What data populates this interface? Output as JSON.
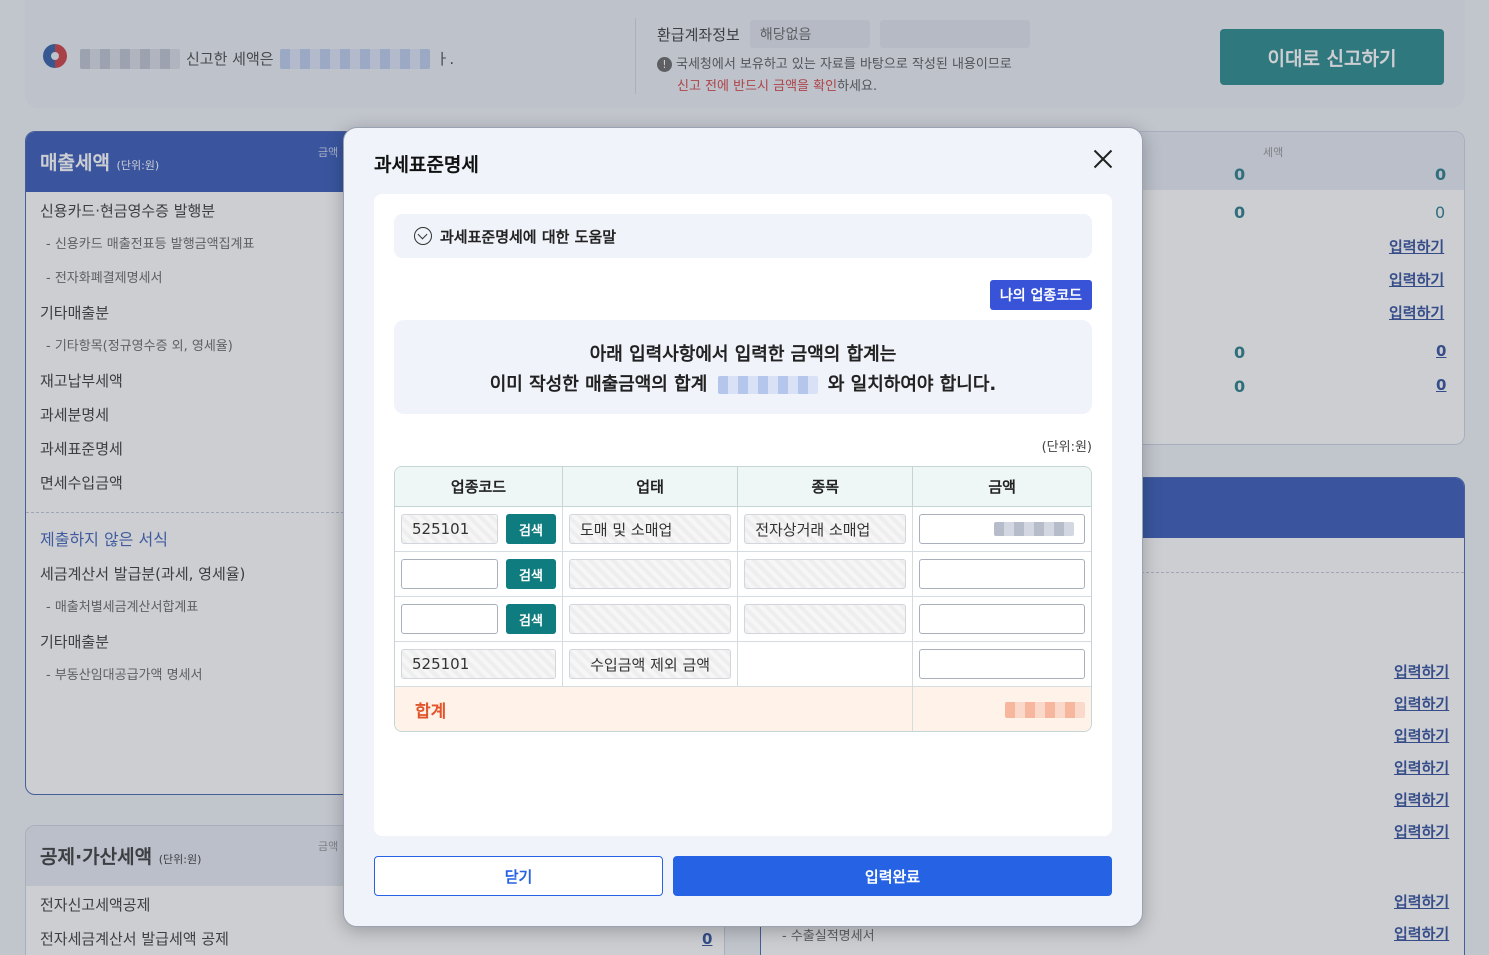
{
  "header": {
    "declared_text": "신고한 세액은",
    "declared_suffix": "ㅏ.",
    "refund_label": "환급계좌정보",
    "refund_value": "해당없음",
    "notice_line1": "국세청에서 보유하고 있는 자료를 바탕으로 작성된 내용이므로",
    "notice_red": "신고 전에 반드시 금액을 확인",
    "notice_tail": "하세요.",
    "report_button": "이대로 신고하기"
  },
  "sales_panel": {
    "title": "매출세액",
    "unit": "(단위:원)",
    "amount_label": "금액",
    "items": [
      {
        "label": "신용카드·현금영수증 발행분",
        "type": "main"
      },
      {
        "label": "- 신용카드 매출전표등 발행금액집계표",
        "type": "sub"
      },
      {
        "label": "- 전자화폐결제명세서",
        "type": "sub"
      },
      {
        "label": "기타매출분",
        "type": "main"
      },
      {
        "label": "- 기타항목(정규영수증 외, 영세율)",
        "type": "sub"
      },
      {
        "label": "재고납부세액",
        "type": "main"
      },
      {
        "label": "과세분명세",
        "type": "main"
      },
      {
        "label": "과세표준명세",
        "type": "main"
      },
      {
        "label": "면세수입금액",
        "type": "main"
      }
    ],
    "unsubmitted_title": "제출하지 않은 서식",
    "unsubmitted_items": [
      {
        "label": "세금계산서 발급분(과세, 영세율)",
        "type": "main"
      },
      {
        "label": "- 매출처별세금계산서합계표",
        "type": "sub"
      },
      {
        "label": "기타매출분",
        "type": "main"
      },
      {
        "label": "- 부동산임대공급가액 명세서",
        "type": "sub"
      }
    ]
  },
  "deduction_panel": {
    "title": "공제·가산세액",
    "unit": "(단위:원)",
    "amount_label": "금액",
    "items": [
      "전자신고세액공제",
      "전자세금계산서 발급세액 공제"
    ],
    "value_zero": "0"
  },
  "right_panel": {
    "tax_label": "세액",
    "zero": "0",
    "link": "입력하기",
    "bottom_sub": "- 수출실적명세서"
  },
  "modal": {
    "title": "과세표준명세",
    "help": "과세표준명세에 대한 도움말",
    "my_code_button": "나의 업종코드",
    "notice_line1": "아래 입력사항에서 입력한 금액의 합계는",
    "notice_line2_pre": "이미 작성한 매출금액의 합계",
    "notice_line2_post": "와 일치하여야 합니다.",
    "unit": "(단위:원)",
    "columns": [
      "업종코드",
      "업태",
      "종목",
      "금액"
    ],
    "search_label": "검색",
    "rows": [
      {
        "code": "525101",
        "biz_type": "도매 및 소매업",
        "item": "전자상거래 소매업"
      },
      {
        "code": "",
        "biz_type": "",
        "item": ""
      },
      {
        "code": "",
        "biz_type": "",
        "item": ""
      },
      {
        "code": "525101",
        "biz_type": "수입금액 제외 금액",
        "item": ""
      }
    ],
    "total_label": "합계",
    "close_button": "닫기",
    "confirm_button": "입력완료"
  }
}
